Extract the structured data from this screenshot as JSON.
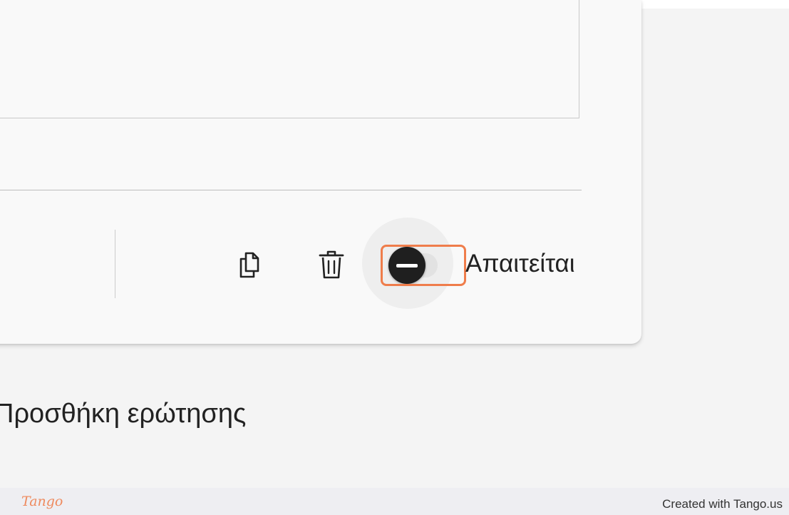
{
  "toolbar": {
    "copy_icon": "copy-icon",
    "delete_icon": "trash-icon",
    "required_label": "Απαιτείται",
    "required_toggle_on": false
  },
  "actions": {
    "add_question": "Προσθήκη ερώτησης"
  },
  "footer": {
    "brand": "Tango",
    "credit": "Created with Tango.us"
  },
  "colors": {
    "highlight": "#ef7d4b",
    "knob": "#1f1f1f",
    "track": "#e2e2e2",
    "background": "#f4f4f4",
    "card": "#f9f9f9"
  }
}
